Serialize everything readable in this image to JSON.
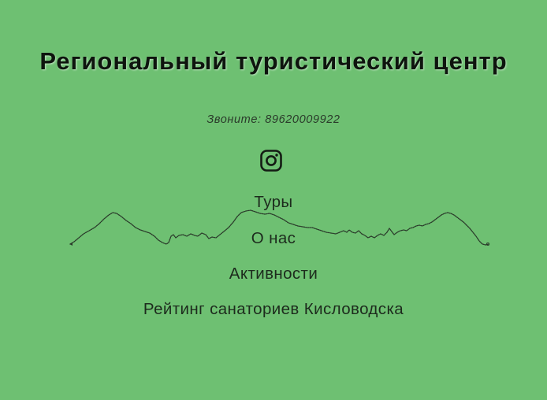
{
  "header": {
    "title": "Региональный туристический центр",
    "phone_text": "Звоните: 89620009922"
  },
  "social": {
    "icon": "instagram-icon"
  },
  "nav": {
    "items": [
      {
        "label": "Туры"
      },
      {
        "label": "О нас"
      },
      {
        "label": "Активности"
      },
      {
        "label": "Рейтинг санаториев Кисловодска"
      }
    ]
  },
  "colors": {
    "background": "#6ec072",
    "text": "#1d2b1d",
    "title": "#0e140e"
  }
}
